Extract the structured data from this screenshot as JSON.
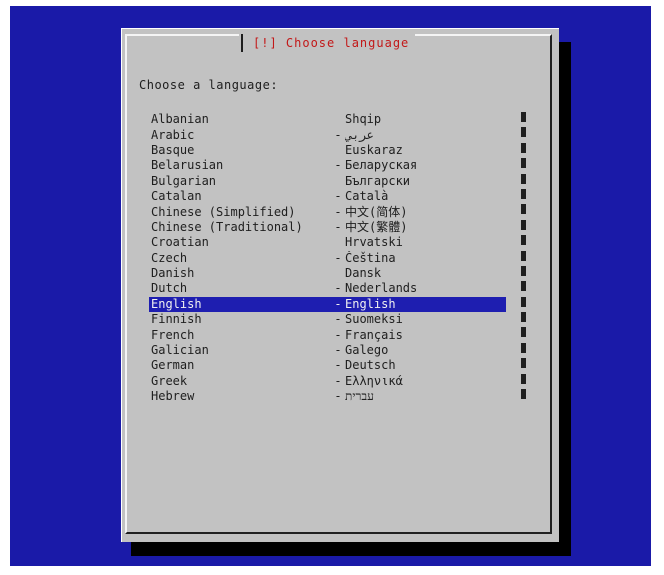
{
  "dialog": {
    "title": "[!] Choose language",
    "prompt": "Choose a language:"
  },
  "languages": [
    {
      "name": "Albanian",
      "separator": "",
      "native": "Shqip"
    },
    {
      "name": "Arabic",
      "separator": "-",
      "native": "عربي"
    },
    {
      "name": "Basque",
      "separator": "",
      "native": "Euskaraz"
    },
    {
      "name": "Belarusian",
      "separator": "-",
      "native": "Беларуская"
    },
    {
      "name": "Bulgarian",
      "separator": "",
      "native": "Български"
    },
    {
      "name": "Catalan",
      "separator": "-",
      "native": "Català"
    },
    {
      "name": "Chinese (Simplified)",
      "separator": "-",
      "native": "中文(简体)"
    },
    {
      "name": "Chinese (Traditional)",
      "separator": "-",
      "native": "中文(繁體)"
    },
    {
      "name": "Croatian",
      "separator": "",
      "native": "Hrvatski"
    },
    {
      "name": "Czech",
      "separator": "-",
      "native": "Čeština"
    },
    {
      "name": "Danish",
      "separator": "",
      "native": "Dansk"
    },
    {
      "name": "Dutch",
      "separator": "-",
      "native": "Nederlands"
    },
    {
      "name": "English",
      "separator": "-",
      "native": "English",
      "selected": true
    },
    {
      "name": "Finnish",
      "separator": "-",
      "native": "Suomeksi"
    },
    {
      "name": "French",
      "separator": "-",
      "native": "Français"
    },
    {
      "name": "Galician",
      "separator": "-",
      "native": "Galego"
    },
    {
      "name": "German",
      "separator": "-",
      "native": "Deutsch"
    },
    {
      "name": "Greek",
      "separator": "-",
      "native": "Ελληνικά"
    },
    {
      "name": "Hebrew",
      "separator": "-",
      "native": "עברית"
    }
  ],
  "scrollbar": {
    "position_marker": "↕",
    "tick_count": 19
  },
  "colors": {
    "screen_background": "#1a1aa8",
    "dialog_background": "#c2c2c2",
    "title_color": "#c21818",
    "selection_background": "#1e1eb0"
  }
}
